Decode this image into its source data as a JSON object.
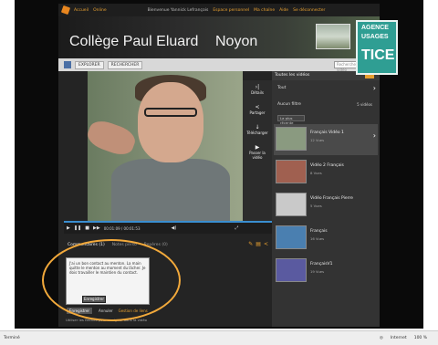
{
  "topbar": {
    "accueil": "Accueil",
    "online": "Online",
    "welcome": "Bienvenue Yannick Lefrançois",
    "my_space": "Espace personnel",
    "channels": "Ma chaîne",
    "aide": "Aide",
    "logout": "Se déconnecter"
  },
  "header": {
    "school": "Collège Paul Eluard",
    "city": "Noyon"
  },
  "agence": {
    "line1": "AGENCE",
    "line2": "USAGES",
    "line3": "TICE"
  },
  "nav": {
    "item1": "EXPLORER",
    "item2": "RECHERCHER",
    "search_placeholder": "Rechercher une vidéo"
  },
  "side_tools": [
    {
      "glyph": "›|",
      "label": "Détails"
    },
    {
      "glyph": "<",
      "label": "Partager"
    },
    {
      "glyph": "↓",
      "label": "Télécharger"
    },
    {
      "glyph": "▶",
      "label": "Passer la vidéo"
    }
  ],
  "playlist": {
    "header": "Toutes les vidéos",
    "section": "Tout",
    "subsection": "Aucun filtre",
    "count": "5 vidéos",
    "sort": "La plus récente",
    "items": [
      {
        "title": "Français Vidéo 1",
        "views": "12 Vues",
        "color": "#8a9a80"
      },
      {
        "title": "Vidéo 2 Français",
        "views": "8 Vues",
        "color": "#a06050"
      },
      {
        "title": "Vidéo Français Pierre",
        "views": "5 Vues",
        "color": "#c9c9c9"
      },
      {
        "title": "Français",
        "views": "16 Vues",
        "color": "#4a7fb0"
      },
      {
        "title": "FrançaisV1",
        "views": "19 Vues",
        "color": "#5a5aa0"
      }
    ]
  },
  "controls": {
    "time": "00:01:09 / 00:01:53"
  },
  "tabs": {
    "comments": "Commentaires (1)",
    "notes": "Notes perso",
    "marks": "Repères (0)"
  },
  "comment": {
    "text": "J'ai un bon contact au menton. La main quitte le menton au moment du lâcher. Je dois travailler le maintien du contact.",
    "save": "Enregistrer"
  },
  "buttons": {
    "save": "Enregistrer",
    "cancel": "Annuler",
    "options": "Gestion de liens"
  },
  "footnote": "Utiliser les flèches pour naviguer dans la vidéo",
  "status": {
    "left": "Terminé",
    "internet": "Internet",
    "zoom": "100 %"
  }
}
